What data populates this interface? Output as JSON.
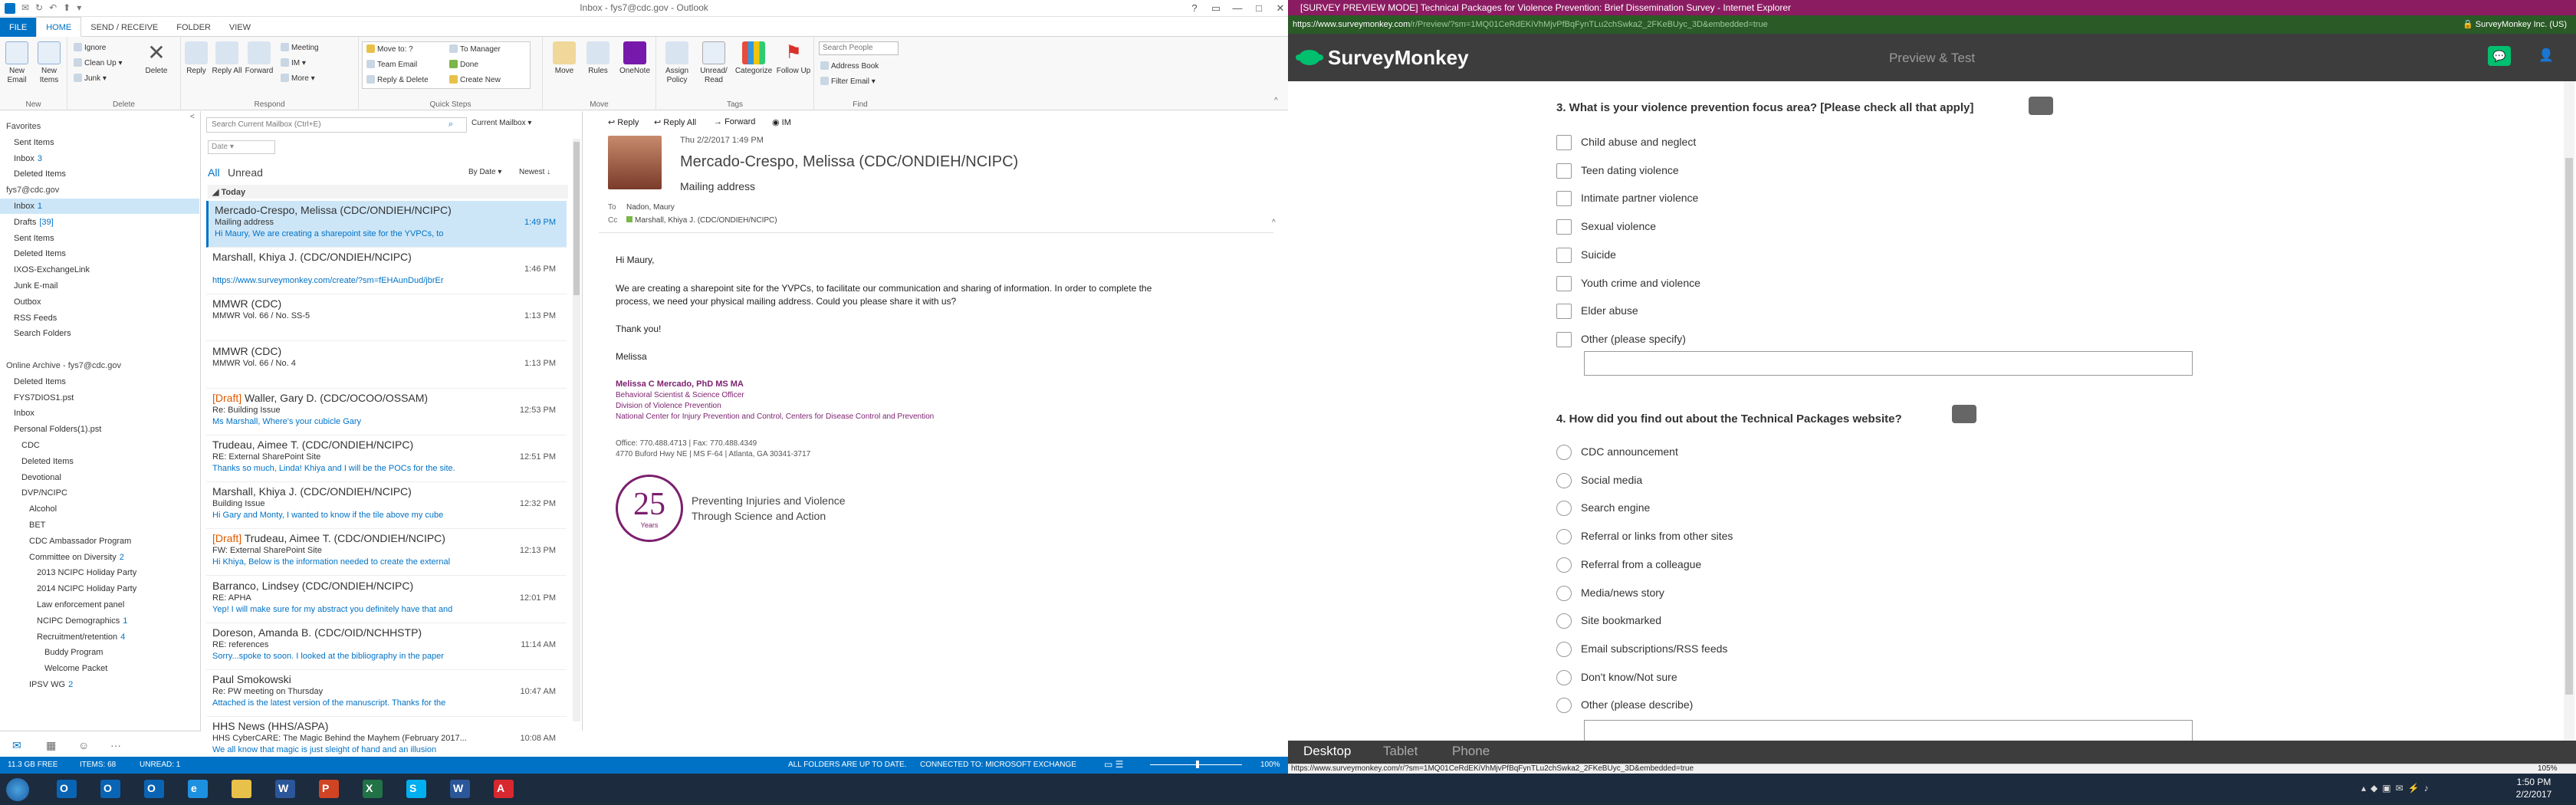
{
  "colors": {
    "outlook_blue": "#0072c6",
    "taskbar": "#1c2b3e",
    "ie_title": "#8b1c62",
    "sm_green": "#00bf6f",
    "sm_dark": "#3d3d3d",
    "draft_orange": "#e05a00"
  },
  "outlook": {
    "title": "Inbox - fys7@cdc.gov - Outlook",
    "tabs": [
      "FILE",
      "HOME",
      "SEND / RECEIVE",
      "FOLDER",
      "VIEW"
    ],
    "ribbon": {
      "new_email": "New Email",
      "new_items": "New Items",
      "ignore": "Ignore",
      "clean_up": "Clean Up",
      "junk": "Junk",
      "delete": "Delete",
      "reply": "Reply",
      "reply_all": "Reply All",
      "forward": "Forward",
      "meeting": "Meeting",
      "im": "IM",
      "more": "More",
      "qs_move_to": "Move to: ?",
      "qs_team_email": "Team Email",
      "qs_reply_delete": "Reply & Delete",
      "qs_to_manager": "To Manager",
      "qs_done": "Done",
      "qs_create_new": "Create New",
      "move": "Move",
      "rules": "Rules",
      "onenote": "OneNote",
      "assign_policy": "Assign Policy",
      "unread_read": "Unread/ Read",
      "categorize": "Categorize",
      "follow_up": "Follow Up",
      "search_people": "Search People",
      "address_book": "Address Book",
      "filter_email": "Filter Email",
      "groups": {
        "new": "New",
        "delete": "Delete",
        "respond": "Respond",
        "quick_steps": "Quick Steps",
        "move": "Move",
        "tags": "Tags",
        "find": "Find"
      }
    },
    "folders": [
      {
        "label": "Favorites",
        "count": "",
        "indent": 0,
        "hdr": true
      },
      {
        "label": "Sent Items",
        "count": "",
        "indent": 1
      },
      {
        "label": "Inbox",
        "count": "3",
        "indent": 1
      },
      {
        "label": "Deleted Items",
        "count": "",
        "indent": 1
      },
      {
        "label": "fys7@cdc.gov",
        "count": "",
        "indent": 0,
        "hdr": true
      },
      {
        "label": "Inbox",
        "count": "1",
        "indent": 1,
        "sel": true
      },
      {
        "label": "Drafts",
        "count": "[39]",
        "indent": 1
      },
      {
        "label": "Sent Items",
        "count": "",
        "indent": 1
      },
      {
        "label": "Deleted Items",
        "count": "",
        "indent": 1
      },
      {
        "label": "IXOS-ExchangeLink",
        "count": "",
        "indent": 1
      },
      {
        "label": "Junk E-mail",
        "count": "",
        "indent": 1
      },
      {
        "label": "Outbox",
        "count": "",
        "indent": 1
      },
      {
        "label": "RSS Feeds",
        "count": "",
        "indent": 1
      },
      {
        "label": "Search Folders",
        "count": "",
        "indent": 1
      },
      {
        "label": "",
        "count": "",
        "indent": 0
      },
      {
        "label": "Online Archive - fys7@cdc.gov",
        "count": "",
        "indent": 0,
        "hdr": true
      },
      {
        "label": "Deleted Items",
        "count": "",
        "indent": 1
      },
      {
        "label": "FYS7DIOS1.pst",
        "count": "",
        "indent": 1
      },
      {
        "label": "Inbox",
        "count": "",
        "indent": 1
      },
      {
        "label": "Personal Folders(1).pst",
        "count": "",
        "indent": 1
      },
      {
        "label": "CDC",
        "count": "",
        "indent": 2
      },
      {
        "label": "Deleted Items",
        "count": "",
        "indent": 2
      },
      {
        "label": "Devotional",
        "count": "",
        "indent": 2
      },
      {
        "label": "DVP/NCIPC",
        "count": "",
        "indent": 2
      },
      {
        "label": "Alcohol",
        "count": "",
        "indent": 3
      },
      {
        "label": "BET",
        "count": "",
        "indent": 3
      },
      {
        "label": "CDC Ambassador Program",
        "count": "",
        "indent": 3
      },
      {
        "label": "Committee on Diversity",
        "count": "2",
        "indent": 3
      },
      {
        "label": "2013 NCIPC Holiday Party",
        "count": "",
        "indent": 4
      },
      {
        "label": "2014 NCIPC Holiday Party",
        "count": "",
        "indent": 4
      },
      {
        "label": "Law enforcement panel",
        "count": "",
        "indent": 4
      },
      {
        "label": "NCIPC Demographics",
        "count": "1",
        "indent": 4
      },
      {
        "label": "Recruitment/retention",
        "count": "4",
        "indent": 4
      },
      {
        "label": "Buddy Program",
        "count": "",
        "indent": 5
      },
      {
        "label": "Welcome Packet",
        "count": "",
        "indent": 5
      },
      {
        "label": "IPSV WG",
        "count": "2",
        "indent": 3
      }
    ],
    "list": {
      "search_placeholder": "Search Current Mailbox (Ctrl+E)",
      "scope": "Current Mailbox",
      "filter_all": "All",
      "filter_unread": "Unread",
      "sort_by": "By Date",
      "sort_order": "Newest",
      "date_box": "Date",
      "group_today": "Today",
      "items": [
        {
          "from": "Mercado-Crespo, Melissa (CDC/ONDIEH/NCIPC)",
          "subject": "Mailing address",
          "preview": "Hi Maury,  We are creating a sharepoint site for the YVPCs, to",
          "time": "1:49 PM",
          "draft": "",
          "sel": true
        },
        {
          "from": "Marshall, Khiya J. (CDC/ONDIEH/NCIPC)",
          "subject": "",
          "preview": "https://www.surveymonkey.com/create/?sm=fEHAunDud/jbrEr",
          "time": "1:46 PM",
          "draft": ""
        },
        {
          "from": "MMWR (CDC)",
          "subject": "MMWR Vol. 66 / No. SS-5",
          "preview": "",
          "time": "1:13 PM",
          "draft": ""
        },
        {
          "from": "MMWR (CDC)",
          "subject": "MMWR Vol. 66 / No. 4",
          "preview": "",
          "time": "1:13 PM",
          "draft": ""
        },
        {
          "from": "Waller, Gary D. (CDC/OCOO/OSSAM)",
          "subject": "Re: Building Issue",
          "preview": "Ms Marshall,  Where's your cubicle  Gary",
          "time": "12:53 PM",
          "draft": "[Draft] "
        },
        {
          "from": "Trudeau, Aimee T. (CDC/ONDIEH/NCIPC)",
          "subject": "RE: External SharePoint Site",
          "preview": "Thanks so much, Linda! Khiya and I will be the POCs for the site.",
          "time": "12:51 PM",
          "draft": ""
        },
        {
          "from": "Marshall, Khiya J. (CDC/ONDIEH/NCIPC)",
          "subject": "Building Issue",
          "preview": "Hi Gary and Monty,  I wanted to know if the tile above my cube",
          "time": "12:32 PM",
          "draft": ""
        },
        {
          "from": "Trudeau, Aimee T. (CDC/ONDIEH/NCIPC)",
          "subject": "FW: External SharePoint Site",
          "preview": "Hi Khiya,  Below is the information needed to create the external",
          "time": "12:13 PM",
          "draft": "[Draft] "
        },
        {
          "from": "Barranco, Lindsey (CDC/ONDIEH/NCIPC)",
          "subject": "RE: APHA",
          "preview": "Yep! I will make sure for my abstract you definitely have that and",
          "time": "12:01 PM",
          "draft": ""
        },
        {
          "from": "Doreson, Amanda B. (CDC/OID/NCHHSTP)",
          "subject": "RE: references",
          "preview": "Sorry...spoke to soon. I looked at the bibliography in the paper",
          "time": "11:14 AM",
          "draft": ""
        },
        {
          "from": "Paul Smokowski",
          "subject": "Re: PW meeting on Thursday",
          "preview": "Attached is the latest version of the manuscript.  Thanks for the",
          "time": "10:47 AM",
          "draft": ""
        },
        {
          "from": "HHS News (HHS/ASPA)",
          "subject": "HHS CyberCARE:  The Magic Behind the Mayhem (February 2017...",
          "preview": "We all know that magic is just sleight of hand and an illusion",
          "time": "10:08 AM",
          "draft": ""
        }
      ]
    },
    "reading": {
      "reply": "Reply",
      "reply_all": "Reply All",
      "forward": "Forward",
      "im": "IM",
      "date": "Thu 2/2/2017 1:49 PM",
      "sender": "Mercado-Crespo, Melissa (CDC/ONDIEH/NCIPC)",
      "subject": "Mailing address",
      "to_label": "To",
      "to": "Nadon, Maury",
      "cc_label": "Cc",
      "cc": "Marshall, Khiya J. (CDC/ONDIEH/NCIPC)",
      "body_greeting": "Hi Maury,",
      "body_p1": "We are creating a sharepoint site for the YVPCs, to facilitate our communication and sharing of information.  In order to complete the",
      "body_p1b": "process, we need your physical mailing address. Could you please share it with us?",
      "body_thanks": "Thank you!",
      "body_sign": "Melissa",
      "sig_name": "Melissa C Mercado, PhD MS MA",
      "sig_title": "Behavioral Scientist & Science Officer",
      "sig_div": "Division of Violence Prevention",
      "sig_center": "National Center for Injury Prevention and Control, Centers for Disease Control and Prevention",
      "sig_phone": "Office: 770.488.4713  |  Fax: 770.488.4349",
      "sig_addr": "4770 Buford Hwy NE  |  MS F-64  |  Atlanta, GA 30341-3717",
      "logo_number": "25",
      "logo_years": "Years",
      "logo_tag1": "Preventing Injuries and Violence",
      "logo_tag2": "Through Science and Action"
    },
    "status": {
      "storage": "11.3 GB FREE",
      "items": "ITEMS: 68",
      "unread": "UNREAD: 1",
      "uptodate": "ALL FOLDERS ARE UP TO DATE.",
      "connected": "CONNECTED TO: MICROSOFT EXCHANGE",
      "zoom": "100%"
    }
  },
  "ie": {
    "title": "[SURVEY PREVIEW MODE] Technical Packages for Violence Prevention: Brief Dissemination Survey - Internet Explorer",
    "url_host": "https://www.surveymonkey.com",
    "url_rest": "/r/Preview/?sm=1MQ01CeRdEKiVhMjvPfBqFynTLu2chSwka2_2FKeBUyc_3D&embedded=true",
    "addr_right": "SurveyMonkey Inc. (US)",
    "status_url": "https://www.surveymonkey.com/r/?sm=1MQ01CeRdEKiVhMjvPfBqFynTLu2chSwka2_2FKeBUyc_3D&embedded=true",
    "zoom": "105%"
  },
  "survey": {
    "brand": "SurveyMonkey",
    "mode": "Preview & Test",
    "q3": "3. What is your violence prevention focus area? [Please check all that apply]",
    "q3_options": [
      "Child abuse and neglect",
      "Teen dating violence",
      "Intimate partner violence",
      "Sexual violence",
      "Suicide",
      "Youth crime and violence",
      "Elder abuse",
      "Other (please specify)"
    ],
    "q4": "4. How did you find out about the Technical Packages website?",
    "q4_options": [
      "CDC announcement",
      "Social media",
      "Search engine",
      "Referral or links from other sites",
      "Referral from a colleague",
      "Media/news story",
      "Site bookmarked",
      "Email subscriptions/RSS feeds",
      "Don't know/Not sure",
      "Other (please describe)"
    ],
    "footer_tabs": [
      "Desktop",
      "Tablet",
      "Phone"
    ]
  },
  "taskbar": {
    "time": "1:50 PM",
    "date": "2/2/2017",
    "apps": [
      {
        "name": "outlook-app-1",
        "letter": "O",
        "color": "#0a64b4"
      },
      {
        "name": "outlook-app-2",
        "letter": "O",
        "color": "#0a64b4"
      },
      {
        "name": "outlook-app-3",
        "letter": "O",
        "color": "#0a64b4"
      },
      {
        "name": "internet-explorer-app",
        "letter": "e",
        "color": "#1e90e0"
      },
      {
        "name": "file-explorer-app",
        "letter": "",
        "color": "#e8c14a"
      },
      {
        "name": "word-app-1",
        "letter": "W",
        "color": "#2b579a"
      },
      {
        "name": "powerpoint-app",
        "letter": "P",
        "color": "#d04423"
      },
      {
        "name": "excel-app",
        "letter": "X",
        "color": "#217346"
      },
      {
        "name": "skype-app",
        "letter": "S",
        "color": "#00aff0"
      },
      {
        "name": "word-app-2",
        "letter": "W",
        "color": "#2b579a"
      },
      {
        "name": "acrobat-app",
        "letter": "A",
        "color": "#d7282f"
      }
    ]
  }
}
